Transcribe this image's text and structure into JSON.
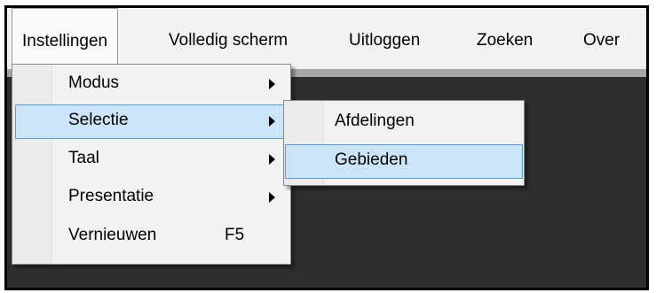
{
  "menubar": {
    "items": [
      "Instellingen",
      "Volledig scherm",
      "Uitloggen",
      "Zoeken",
      "Over"
    ]
  },
  "settings_menu": {
    "items": [
      {
        "label": "Modus",
        "submenu": true
      },
      {
        "label": "Selectie",
        "submenu": true,
        "highlighted": true
      },
      {
        "label": "Taal",
        "submenu": true
      },
      {
        "label": "Presentatie",
        "submenu": true
      },
      {
        "label": "Vernieuwen",
        "shortcut": "F5"
      }
    ]
  },
  "selection_submenu": {
    "items": [
      {
        "label": "Afdelingen"
      },
      {
        "label": "Gebieden",
        "highlighted": true
      }
    ]
  },
  "colors": {
    "menubar_bg": "#f2f2f2",
    "content_bg": "#2e2e2e",
    "highlight_bg": "#cce4f7",
    "highlight_border": "#569de5"
  }
}
